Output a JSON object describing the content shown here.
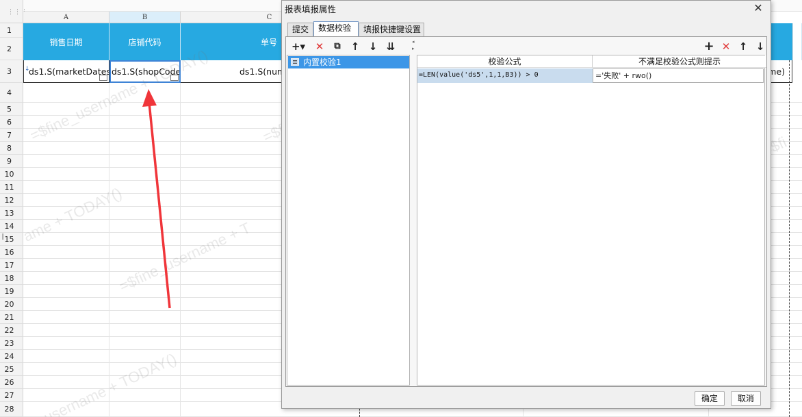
{
  "sheet": {
    "columns": [
      "A",
      "B",
      "C"
    ],
    "rows": [
      "1",
      "2",
      "3",
      "4",
      "5",
      "6",
      "7",
      "8",
      "9",
      "10",
      "11",
      "12",
      "13",
      "14",
      "15",
      "16",
      "17",
      "18",
      "19",
      "20",
      "21",
      "22",
      "23",
      "24",
      "25",
      "26",
      "27",
      "28"
    ],
    "header_cells": [
      "销售日期",
      "店铺代码",
      "单号"
    ],
    "data_cells": [
      "ds1.S(marketDates)",
      "ds1.S(shopCode)",
      "ds1.S(num"
    ],
    "right_partial_cell": "me)",
    "watermarks": [
      "=$fine_username + TODAY()",
      "=$fine_username + TODAY()",
      "ame + TODAY()",
      "=$fine_username + T",
      "=$fine_username + TODAY()",
      "username + TODAY()",
      "=$fine_",
      "=$fi"
    ]
  },
  "dialog": {
    "title": "报表填报属性",
    "close_glyph": "✕",
    "tabs": [
      "提交",
      "数据校验",
      "填报快捷键设置"
    ],
    "active_tab": "数据校验",
    "left_toolbar": [
      "+▾",
      "✕",
      "⧉",
      "↑",
      "↓",
      "⇊"
    ],
    "list_items": [
      "内置校验1"
    ],
    "right_toolbar": [
      "+",
      "✕",
      "↑",
      "↓"
    ],
    "grid_headers": [
      "校验公式",
      "不满足校验公式则提示"
    ],
    "grid_rows": [
      {
        "formula": "=LEN(value('ds5',1,1,B3)) > 0",
        "message": "='失败' + rwo()"
      }
    ],
    "ok_label": "确定",
    "cancel_label": "取消"
  },
  "colors": {
    "header_blue": "#27a9e1",
    "selection_blue": "#3c96e7",
    "annotation_red": "#f0353a",
    "delete_red": "#e03a3a"
  }
}
